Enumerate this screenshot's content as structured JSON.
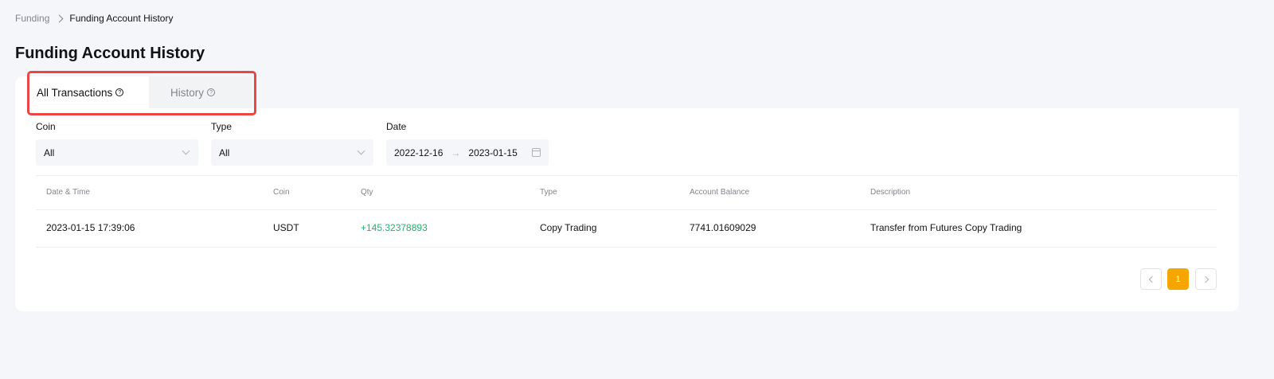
{
  "breadcrumb": {
    "parent": "Funding",
    "current": "Funding Account History"
  },
  "page_title": "Funding Account History",
  "tabs": [
    {
      "label": "All Transactions",
      "active": true
    },
    {
      "label": "History",
      "active": false
    }
  ],
  "help_icon_glyph": "?",
  "filters": {
    "coin": {
      "label": "Coin",
      "value": "All"
    },
    "type": {
      "label": "Type",
      "value": "All"
    },
    "date": {
      "label": "Date",
      "start": "2022-12-16",
      "arrow": "→",
      "end": "2023-01-15"
    }
  },
  "table": {
    "headers": [
      "Date & Time",
      "Coin",
      "Qty",
      "Type",
      "Account Balance",
      "Description"
    ],
    "rows": [
      [
        "2023-01-15 17:39:06",
        "USDT",
        "+145.32378893",
        "Copy Trading",
        "7741.01609029",
        "Transfer from Futures Copy Trading"
      ]
    ]
  },
  "pagination": {
    "current_page": "1"
  },
  "colors": {
    "accent": "#f7a600",
    "positive": "#20b26c",
    "highlight": "#e94645"
  }
}
